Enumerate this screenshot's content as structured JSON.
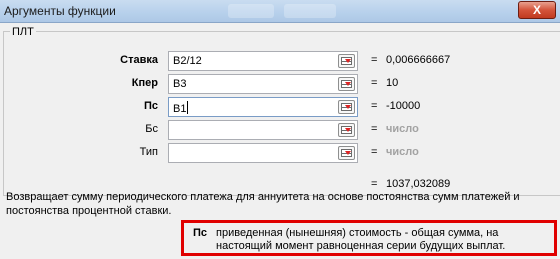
{
  "window": {
    "title": "Аргументы функции",
    "close_label": "X"
  },
  "group": {
    "function_name": "ПЛТ"
  },
  "args": [
    {
      "label": "Ставка",
      "value": "B2/12",
      "result": "0,006666667",
      "is_placeholder": false,
      "bold": true
    },
    {
      "label": "Кпер",
      "value": "B3",
      "result": "10",
      "is_placeholder": false,
      "bold": true
    },
    {
      "label": "Пс",
      "value": "B1",
      "result": "-10000",
      "is_placeholder": false,
      "bold": true
    },
    {
      "label": "Бс",
      "value": "",
      "result": "число",
      "is_placeholder": true,
      "bold": false
    },
    {
      "label": "Тип",
      "value": "",
      "result": "число",
      "is_placeholder": true,
      "bold": false
    }
  ],
  "equals_sign": "=",
  "final_result": "1037,032089",
  "description": "Возвращает сумму периодического платежа для аннуитета на основе постоянства сумм платежей и постоянства процентной ставки.",
  "hint": {
    "arg_name": "Пс",
    "text": "приведенная (нынешняя) стоимость - общая сумма, на настоящий момент равноценная серии будущих выплат."
  },
  "colors": {
    "highlight_border": "#e00000",
    "placeholder_text": "#a3a3a3"
  }
}
